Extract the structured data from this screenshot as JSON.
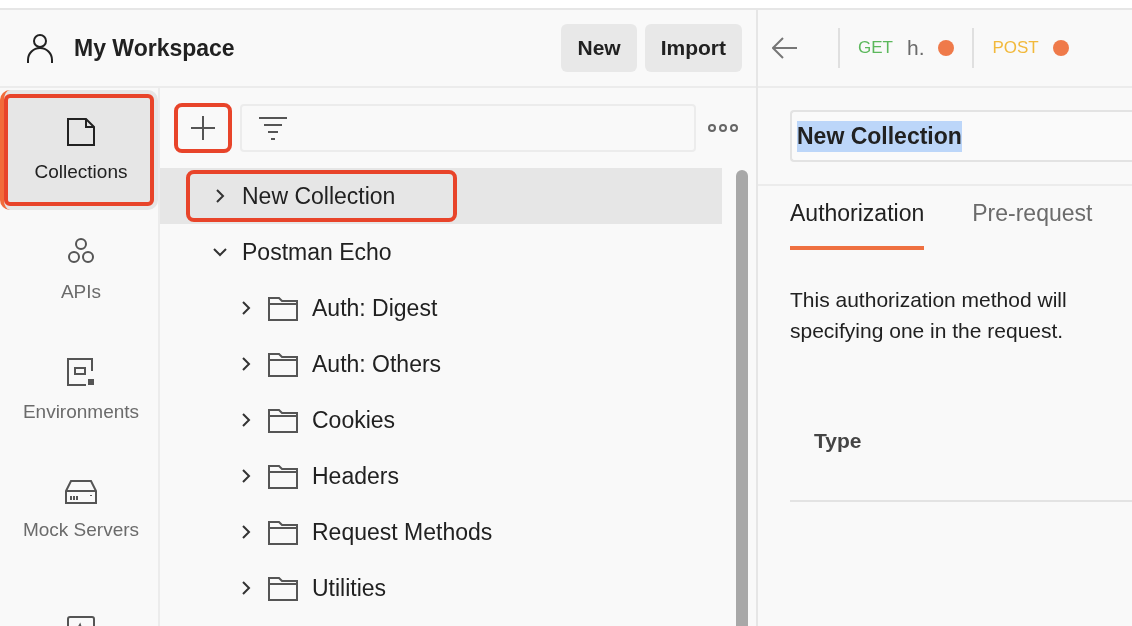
{
  "workspace": {
    "title": "My Workspace",
    "buttons": [
      "New",
      "Import"
    ]
  },
  "sidebar": {
    "items": [
      {
        "label": "Collections",
        "kind": "collection",
        "selected": true,
        "highlighted": true
      },
      {
        "label": "APIs",
        "kind": "apis",
        "selected": false,
        "highlighted": false
      },
      {
        "label": "Environments",
        "kind": "environment",
        "selected": false,
        "highlighted": false
      },
      {
        "label": "Mock Servers",
        "kind": "server",
        "selected": false,
        "highlighted": false
      },
      {
        "kind": "monitor",
        "selected": false,
        "highlighted": false
      }
    ]
  },
  "toolbar": {
    "add_highlighted": true
  },
  "tree": [
    {
      "label": "New Collection",
      "kind": "collection",
      "expanded": false,
      "selected": true,
      "highlighted": true
    },
    {
      "label": "Postman Echo",
      "kind": "collection",
      "expanded": true,
      "selected": false,
      "highlighted": false,
      "children": [
        {
          "label": "Auth: Digest",
          "kind": "folder",
          "expanded": false,
          "selected": false,
          "highlighted": false
        },
        {
          "label": "Auth: Others",
          "kind": "folder",
          "expanded": false,
          "selected": false,
          "highlighted": false
        },
        {
          "label": "Cookies",
          "kind": "folder",
          "expanded": false,
          "selected": false,
          "highlighted": false
        },
        {
          "label": "Headers",
          "kind": "folder",
          "expanded": false,
          "selected": false,
          "highlighted": false
        },
        {
          "label": "Request Methods",
          "kind": "folder",
          "expanded": false,
          "selected": false,
          "highlighted": false
        },
        {
          "label": "Utilities",
          "kind": "folder",
          "expanded": false,
          "selected": false,
          "highlighted": false
        }
      ]
    }
  ],
  "request_tabs": [
    {
      "method": "GET",
      "label": "h.",
      "color": "#5cb85c",
      "unsaved": true
    },
    {
      "method": "POST",
      "color": "#f2b93b",
      "unsaved": true
    }
  ],
  "editor": {
    "name": "New Collection",
    "name_selected": true,
    "tabs": [
      {
        "label": "Authorization",
        "selected": true
      },
      {
        "label": "Pre-request",
        "selected": false
      }
    ],
    "description": "This authorization method will\nspecifying one in the request.",
    "type_label": "Type"
  }
}
